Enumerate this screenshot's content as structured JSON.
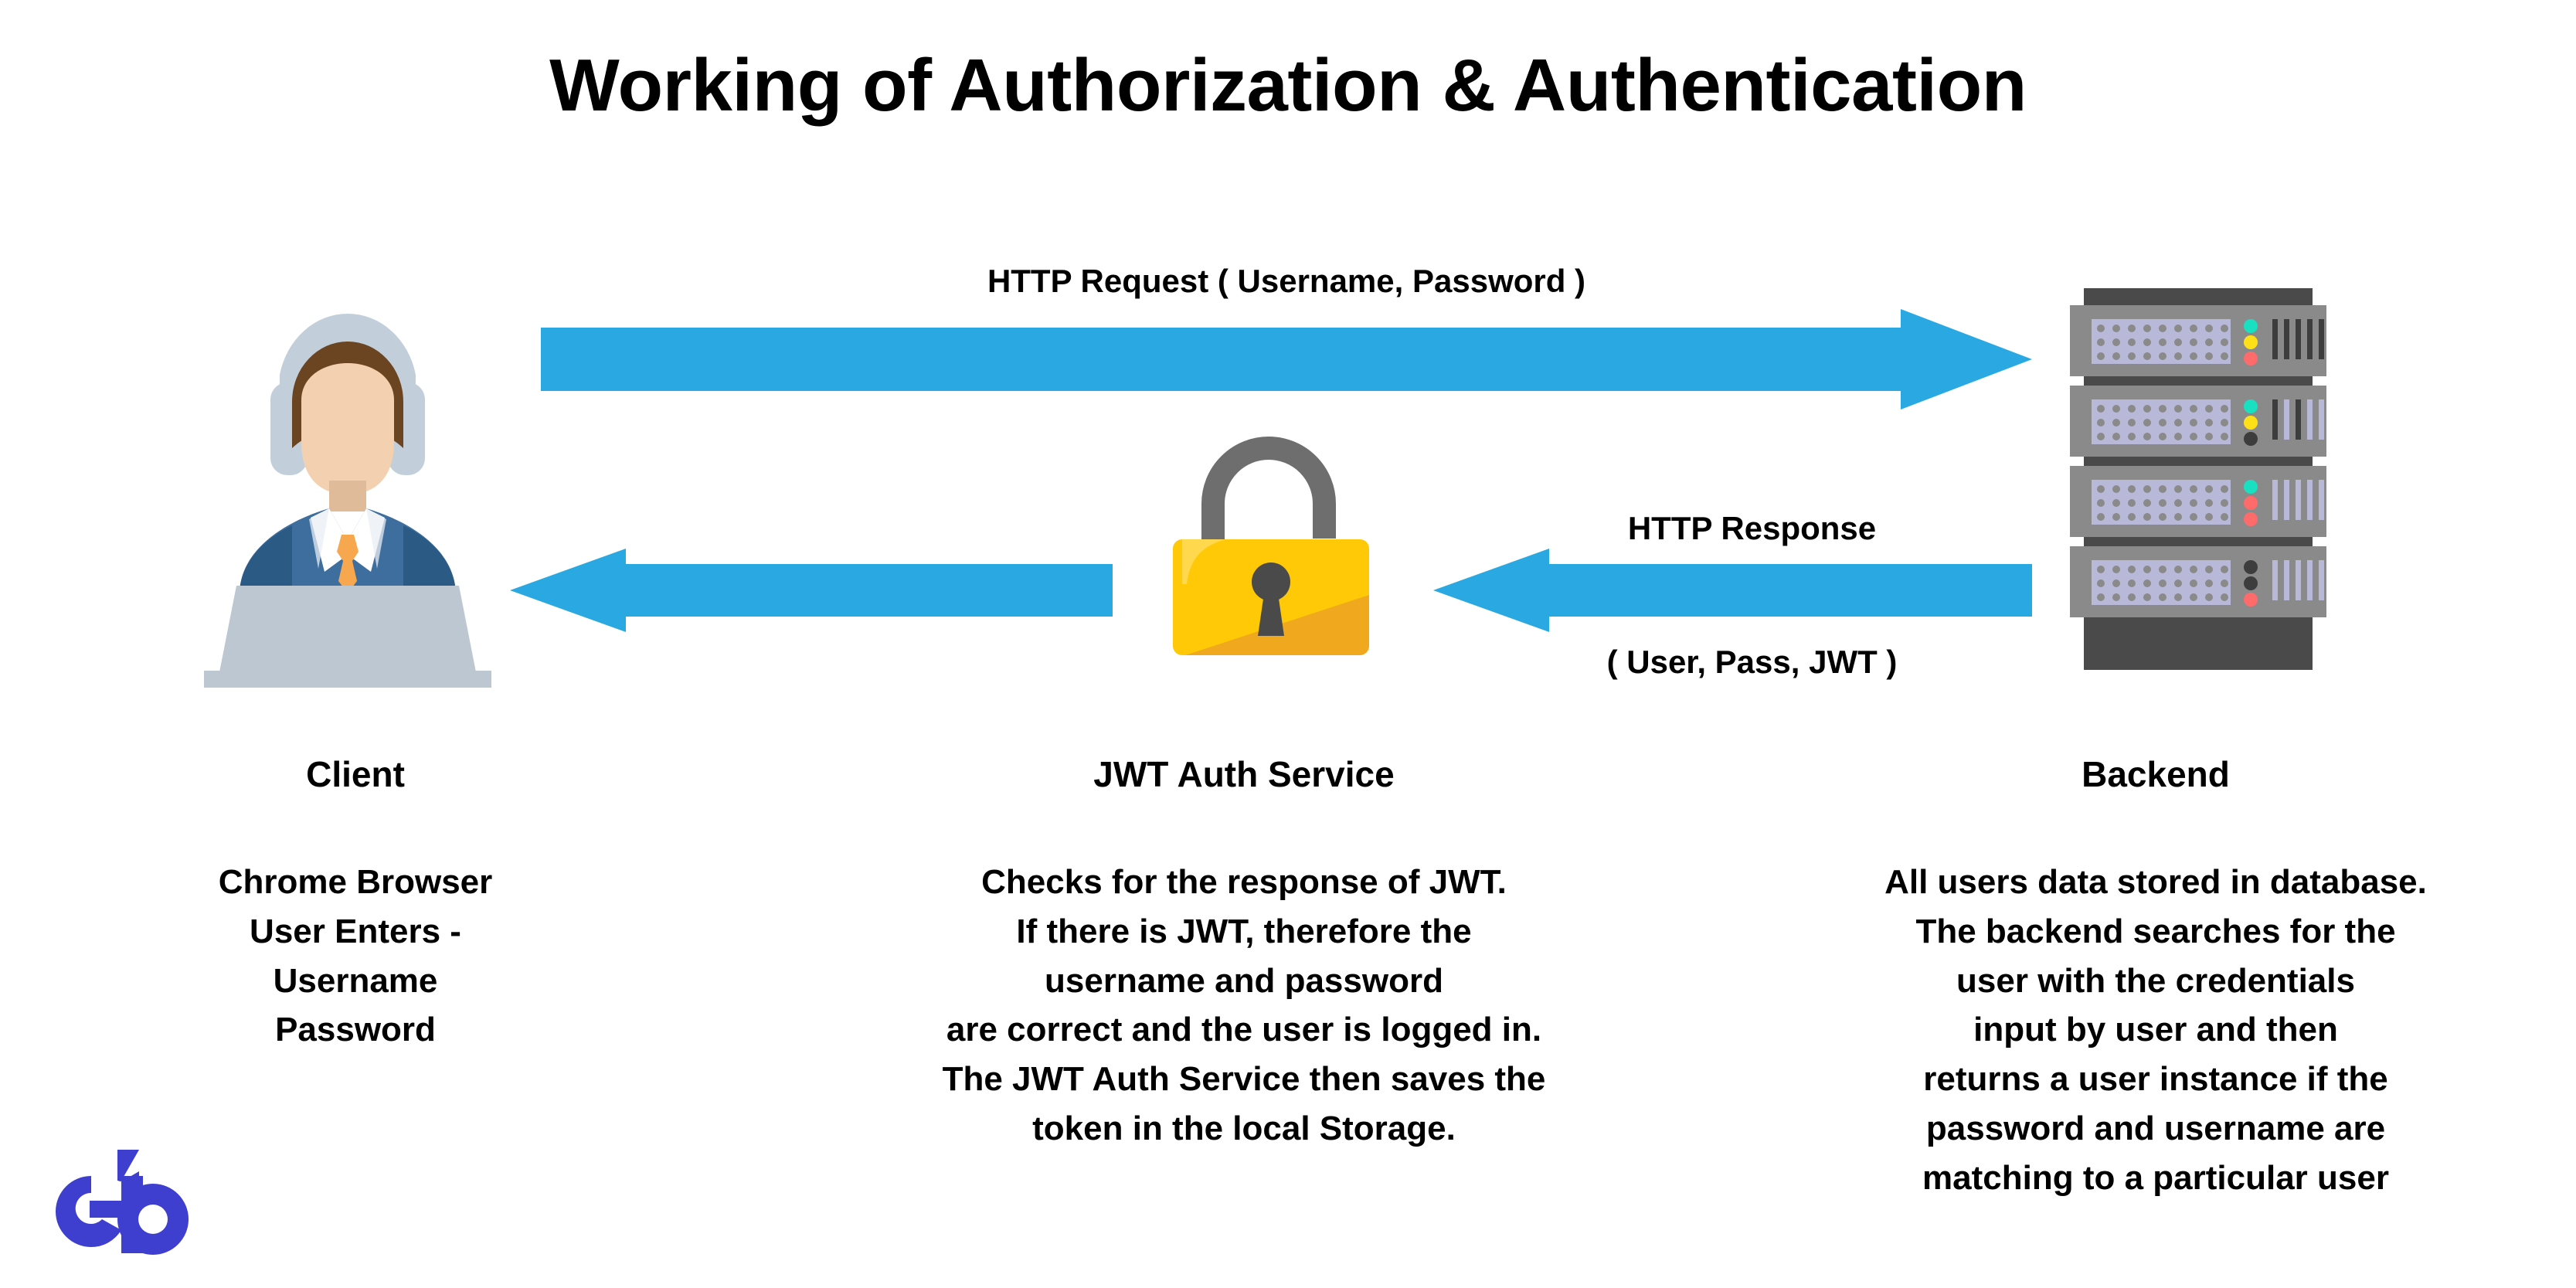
{
  "title": "Working of Authorization & Authentication",
  "colors": {
    "arrow_blue": "#29a8e1",
    "lock_yellow": "#ffc907",
    "lock_yellow_dark": "#f0a91e",
    "shackle_gray": "#6e6e6e",
    "keyhole_dark": "#4a4a4a",
    "server_body": "#8a8a8a",
    "server_dark": "#4a4a4a",
    "server_vent": "#b8b8d8",
    "led_green": "#19e0c0",
    "led_yellow": "#ffe017",
    "led_red": "#ff6b6b",
    "led_off": "#3d3d3d",
    "suit_blue": "#3d6e9e",
    "suit_blue_dark": "#2b5a85",
    "skin": "#f2d0b0",
    "hair_brown": "#6b4421",
    "headset_gray": "#c2cfdb",
    "laptop_gray": "#bcc7d2",
    "tie_orange": "#f7a74e",
    "shirt_white": "#ffffff",
    "logo_blue": "#3f3fcf",
    "text_black": "#000000",
    "background": "#ffffff"
  },
  "arrows": {
    "request": {
      "label": "HTTP Request ( Username, Password )",
      "direction": "right",
      "from": "Client",
      "to": "Backend"
    },
    "response_server_to_jwt": {
      "label_top": "HTTP Response",
      "label_bottom": "( User, Pass, JWT )",
      "direction": "left",
      "from": "Backend",
      "to": "JWT Auth Service"
    },
    "response_jwt_to_client": {
      "direction": "left",
      "from": "JWT Auth Service",
      "to": "Client"
    }
  },
  "columns": [
    {
      "id": "client",
      "heading": "Client",
      "icon": "user-with-headset-at-laptop-icon",
      "body_lines": [
        "Chrome Browser",
        "User Enters -",
        "Username",
        "Password"
      ]
    },
    {
      "id": "jwt-auth-service",
      "heading": "JWT Auth Service",
      "icon": "open-padlock-icon",
      "body_lines": [
        "Checks for the response of JWT.",
        "If there is JWT, therefore the",
        "username and password",
        "are correct and the user is logged in.",
        "The JWT Auth Service then saves the",
        "token in the local Storage."
      ]
    },
    {
      "id": "backend",
      "heading": "Backend",
      "icon": "server-rack-icon",
      "body_lines": [
        "All users data stored in database.",
        "The backend searches for the",
        "user with the credentials",
        "input by user and then",
        "returns a user instance if the",
        "password and username are",
        "matching to a particular user"
      ]
    }
  ],
  "logo": {
    "name": "eb-logo",
    "text": "eb"
  }
}
